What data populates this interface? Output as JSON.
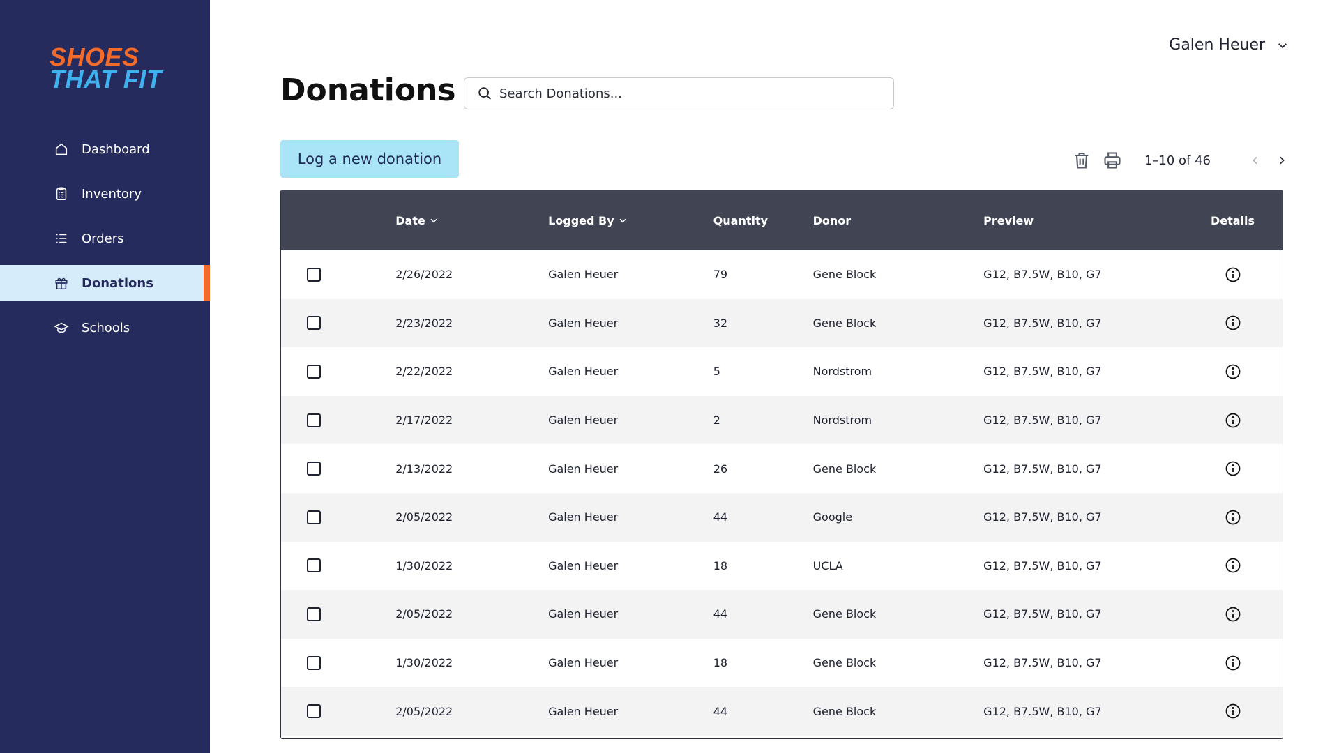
{
  "brand": {
    "line1": "SHOES",
    "line2": "THAT FIT"
  },
  "sidebar": {
    "items": [
      {
        "label": "Dashboard",
        "icon": "home-icon"
      },
      {
        "label": "Inventory",
        "icon": "clipboard-icon"
      },
      {
        "label": "Orders",
        "icon": "list-icon"
      },
      {
        "label": "Donations",
        "icon": "gift-icon",
        "active": true
      },
      {
        "label": "Schools",
        "icon": "graduation-cap-icon"
      }
    ]
  },
  "header": {
    "user_name": "Galen Heuer",
    "title": "Donations",
    "search_placeholder": "Search Donations..."
  },
  "toolbar": {
    "log_button_label": "Log a new donation",
    "pagination": "1–10 of 46"
  },
  "table": {
    "columns": {
      "date": "Date",
      "logged_by": "Logged By",
      "quantity": "Quantity",
      "donor": "Donor",
      "preview": "Preview",
      "details": "Details"
    },
    "rows": [
      {
        "date": "2/26/2022",
        "logged_by": "Galen Heuer",
        "quantity": "79",
        "donor": "Gene Block",
        "preview": "G12, B7.5W, B10, G7"
      },
      {
        "date": "2/23/2022",
        "logged_by": "Galen Heuer",
        "quantity": "32",
        "donor": "Gene Block",
        "preview": "G12, B7.5W, B10, G7"
      },
      {
        "date": "2/22/2022",
        "logged_by": "Galen Heuer",
        "quantity": "5",
        "donor": "Nordstrom",
        "preview": "G12, B7.5W, B10, G7"
      },
      {
        "date": "2/17/2022",
        "logged_by": "Galen Heuer",
        "quantity": "2",
        "donor": "Nordstrom",
        "preview": "G12, B7.5W, B10, G7"
      },
      {
        "date": "2/13/2022",
        "logged_by": "Galen Heuer",
        "quantity": "26",
        "donor": "Gene Block",
        "preview": "G12, B7.5W, B10, G7"
      },
      {
        "date": "2/05/2022",
        "logged_by": "Galen Heuer",
        "quantity": "44",
        "donor": "Google",
        "preview": "G12, B7.5W, B10, G7"
      },
      {
        "date": "1/30/2022",
        "logged_by": "Galen Heuer",
        "quantity": "18",
        "donor": "UCLA",
        "preview": "G12, B7.5W, B10, G7"
      },
      {
        "date": "2/05/2022",
        "logged_by": "Galen Heuer",
        "quantity": "44",
        "donor": "Gene Block",
        "preview": "G12, B7.5W, B10, G7"
      },
      {
        "date": "1/30/2022",
        "logged_by": "Galen Heuer",
        "quantity": "18",
        "donor": "Gene Block",
        "preview": "G12, B7.5W, B10, G7"
      },
      {
        "date": "2/05/2022",
        "logged_by": "Galen Heuer",
        "quantity": "44",
        "donor": "Gene Block",
        "preview": "G12, B7.5W, B10, G7"
      }
    ]
  },
  "colors": {
    "sidebar_bg": "#262b5e",
    "accent_orange": "#f26b2b",
    "accent_blue": "#3fb1ee",
    "active_nav_bg": "#d7ecfb",
    "button_bg": "#a9e4f7",
    "table_header_bg": "#414452"
  }
}
